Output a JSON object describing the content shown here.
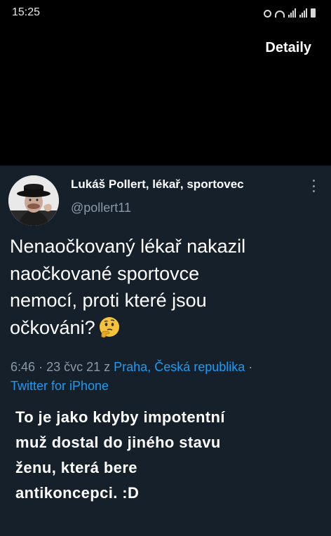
{
  "status_bar": {
    "time": "15:25",
    "icons": [
      "alarm-icon",
      "wifi-icon",
      "signal-icon",
      "signal-icon",
      "battery-icon"
    ]
  },
  "header": {
    "details_label": "Detaily"
  },
  "tweet": {
    "author_name": "Lukáš Pollert, lékař, sportovec",
    "handle": "@pollert11",
    "text_lines": [
      "Nenaočkovaný lékař nakazil",
      "naočkované sportovce",
      "nemocí, proti které jsou",
      "očkováni?"
    ],
    "emoji": "thinking-face-icon",
    "time": "6:46",
    "date": "23 čvc 21",
    "location_prefix": "z",
    "location": "Praha, Česká republika",
    "separator": "·",
    "source": "Twitter for iPhone"
  },
  "caption": {
    "lines": [
      "To je jako kdyby impotentní",
      "muž dostal do jiného stavu",
      "ženu, která bere",
      "antikoncepci. :D"
    ]
  },
  "colors": {
    "background": "#000000",
    "tweet_background": "#15202b",
    "muted_text": "#8b98a5",
    "link": "#1d9bf0",
    "emoji": "#f5c33b"
  }
}
